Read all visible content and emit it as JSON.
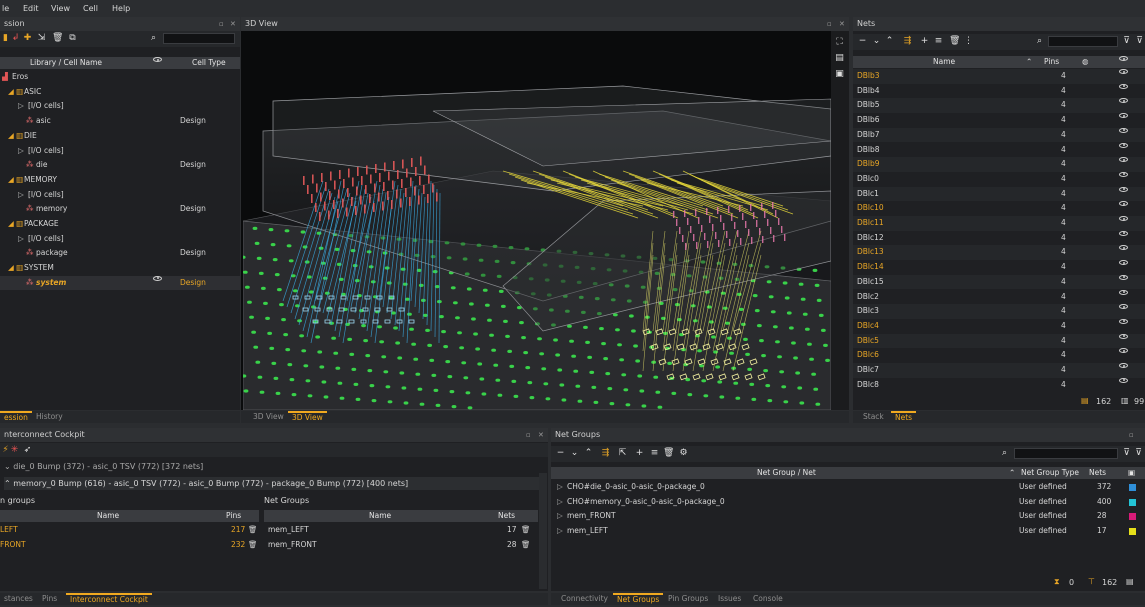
{
  "menu": [
    "le",
    "Edit",
    "View",
    "Cell",
    "Help"
  ],
  "session": {
    "title": "ssion",
    "col_name": "Library / Cell Name",
    "col_type": "Cell Type",
    "rows": [
      {
        "label": "Eros",
        "type": "",
        "level": 0,
        "icon": "root-icon"
      },
      {
        "label": "ASIC",
        "type": "",
        "level": 1,
        "icon": "library-icon"
      },
      {
        "label": "[I/O cells]",
        "type": "",
        "level": 2,
        "icon": "expand-icon"
      },
      {
        "label": "asic",
        "type": "Design",
        "level": 3,
        "icon": "cell-icon"
      },
      {
        "label": "DIE",
        "type": "",
        "level": 1,
        "icon": "library-icon"
      },
      {
        "label": "[I/O cells]",
        "type": "",
        "level": 2,
        "icon": "expand-icon"
      },
      {
        "label": "die",
        "type": "Design",
        "level": 3,
        "icon": "cell-icon"
      },
      {
        "label": "MEMORY",
        "type": "",
        "level": 1,
        "icon": "library-icon"
      },
      {
        "label": "[I/O cells]",
        "type": "",
        "level": 2,
        "icon": "expand-icon"
      },
      {
        "label": "memory",
        "type": "Design",
        "level": 3,
        "icon": "cell-icon"
      },
      {
        "label": "PACKAGE",
        "type": "",
        "level": 1,
        "icon": "library-icon"
      },
      {
        "label": "[I/O cells]",
        "type": "",
        "level": 2,
        "icon": "expand-icon"
      },
      {
        "label": "package",
        "type": "Design",
        "level": 3,
        "icon": "cell-icon"
      },
      {
        "label": "SYSTEM",
        "type": "",
        "level": 1,
        "icon": "library-icon"
      },
      {
        "label": "system",
        "type": "Design",
        "level": 3,
        "icon": "cell-icon",
        "selected": true
      }
    ],
    "tabs": [
      "ession",
      "History"
    ]
  },
  "view3d": {
    "title": "3D View",
    "tabs": [
      "3D View",
      "3D View"
    ]
  },
  "nets": {
    "title": "Nets",
    "col_name": "Name",
    "col_pins": "Pins",
    "rows": [
      {
        "name": "DBlb3",
        "pins": "4",
        "hl": true
      },
      {
        "name": "DBlb4",
        "pins": "4",
        "hl": false
      },
      {
        "name": "DBlb5",
        "pins": "4",
        "hl": false
      },
      {
        "name": "DBlb6",
        "pins": "4",
        "hl": false
      },
      {
        "name": "DBlb7",
        "pins": "4",
        "hl": false
      },
      {
        "name": "DBlb8",
        "pins": "4",
        "hl": false
      },
      {
        "name": "DBlb9",
        "pins": "4",
        "hl": true
      },
      {
        "name": "DBlc0",
        "pins": "4",
        "hl": false
      },
      {
        "name": "DBlc1",
        "pins": "4",
        "hl": false
      },
      {
        "name": "DBlc10",
        "pins": "4",
        "hl": true
      },
      {
        "name": "DBlc11",
        "pins": "4",
        "hl": true
      },
      {
        "name": "DBlc12",
        "pins": "4",
        "hl": false
      },
      {
        "name": "DBlc13",
        "pins": "4",
        "hl": true
      },
      {
        "name": "DBlc14",
        "pins": "4",
        "hl": true
      },
      {
        "name": "DBlc15",
        "pins": "4",
        "hl": false
      },
      {
        "name": "DBlc2",
        "pins": "4",
        "hl": false
      },
      {
        "name": "DBlc3",
        "pins": "4",
        "hl": false
      },
      {
        "name": "DBlc4",
        "pins": "4",
        "hl": true
      },
      {
        "name": "DBlc5",
        "pins": "4",
        "hl": true
      },
      {
        "name": "DBlc6",
        "pins": "4",
        "hl": true
      },
      {
        "name": "DBlc7",
        "pins": "4",
        "hl": false
      },
      {
        "name": "DBlc8",
        "pins": "4",
        "hl": false
      }
    ],
    "count": "162",
    "count2": "99",
    "tabs": [
      "Stack",
      "Nets"
    ]
  },
  "cockpit": {
    "title": "nterconnect Cockpit",
    "path1": "die_0 Bump (372) - asic_0 TSV (772) [372 nets]",
    "path2": "memory_0 Bump (616) - asic_0 TSV (772) - asic_0 Bump (772) - package_0 Bump (772) [400 nets]",
    "left_title": "n groups",
    "left_col_name": "Name",
    "left_col_pins": "Pins",
    "left_rows": [
      {
        "name": "LEFT",
        "pins": "217"
      },
      {
        "name": "FRONT",
        "pins": "232"
      }
    ],
    "right_title": "Net Groups",
    "right_col_name": "Name",
    "right_col_nets": "Nets",
    "right_rows": [
      {
        "name": "mem_LEFT",
        "nets": "17"
      },
      {
        "name": "mem_FRONT",
        "nets": "28"
      }
    ],
    "tabs": [
      "stances",
      "Pins",
      "Interconnect Cockpit"
    ]
  },
  "netgroups": {
    "title": "Net Groups",
    "col_name": "Net Group / Net",
    "col_type": "Net Group Type",
    "col_nets": "Nets",
    "rows": [
      {
        "name": "CHO#die_0-asic_0-asic_0-package_0",
        "type": "User defined",
        "nets": "372",
        "color": "#2f8fd8"
      },
      {
        "name": "CHO#memory_0-asic_0-asic_0-package_0",
        "type": "User defined",
        "nets": "400",
        "color": "#23c4d6"
      },
      {
        "name": "mem_FRONT",
        "type": "User defined",
        "nets": "28",
        "color": "#d81b78"
      },
      {
        "name": "mem_LEFT",
        "type": "User defined",
        "nets": "17",
        "color": "#e6e01a"
      }
    ],
    "count1": "0",
    "count2": "162",
    "tabs": [
      "Connectivity",
      "Net Groups",
      "Pin Groups",
      "Issues",
      "Console"
    ]
  }
}
